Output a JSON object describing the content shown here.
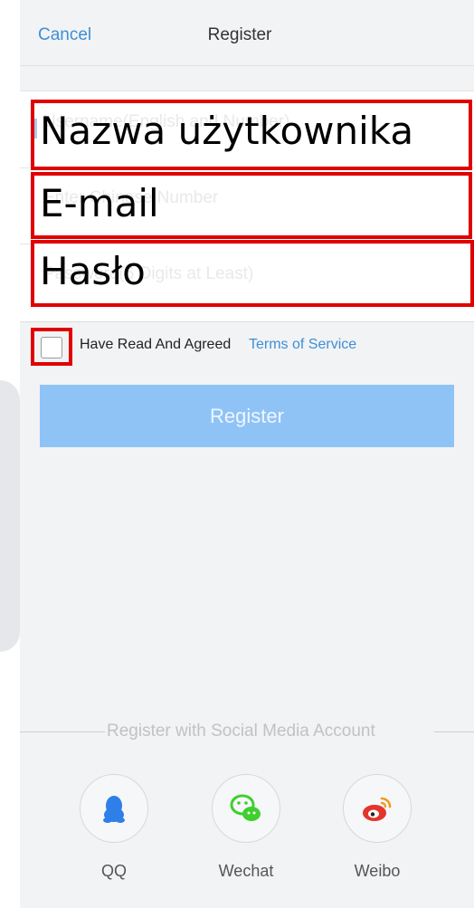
{
  "nav": {
    "cancel_label": "Cancel",
    "title": "Register"
  },
  "form": {
    "username_placeholder": "Username(English and Number)",
    "phone_placeholder": "Enter Chinese Number",
    "password_placeholder": "Password(6 Digits at Least)"
  },
  "overlays": {
    "username_label": "Nazwa użytkownika",
    "email_label": "E-mail",
    "password_label": "Hasło",
    "highlight_color": "#e00000"
  },
  "agreement": {
    "text": "Have Read And Agreed",
    "link": "Terms of Service",
    "checked": false
  },
  "register_button": {
    "label": "Register",
    "color": "#8fc3f6"
  },
  "social": {
    "heading": "Register with Social Media Account",
    "items": [
      {
        "label": "QQ",
        "icon": "qq-penguin-icon",
        "color": "#2e7fe8"
      },
      {
        "label": "Wechat",
        "icon": "wechat-icon",
        "color": "#3fcf2e"
      },
      {
        "label": "Weibo",
        "icon": "weibo-icon",
        "color": "#e3352b"
      }
    ]
  },
  "accent_color": "#3d8fd6"
}
